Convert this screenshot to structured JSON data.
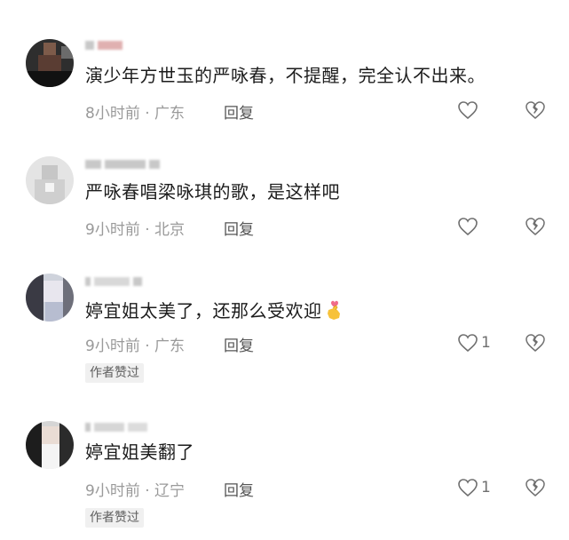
{
  "comments": [
    {
      "text": "演少年方世玉的严咏春，不提醒，完全认不出来。",
      "time": "8小时前",
      "location": "广东",
      "reply_label": "回复",
      "like_count": ""
    },
    {
      "text": "严咏春唱梁咏琪的歌，是这样吧",
      "time": "9小时前",
      "location": "北京",
      "reply_label": "回复",
      "like_count": ""
    },
    {
      "text": "婷宜姐太美了，还那么受欢迎",
      "time": "9小时前",
      "location": "广东",
      "reply_label": "回复",
      "like_count": "1",
      "badge": "作者赞过"
    },
    {
      "text": "婷宜姐美翻了",
      "time": "9小时前",
      "location": "辽宁",
      "reply_label": "回复",
      "like_count": "1",
      "badge": "作者赞过"
    }
  ],
  "separator": " · ",
  "icons": {
    "like": "heart-outline-icon",
    "dislike": "broken-heart-icon",
    "emoji": "heart-hand-emoji"
  },
  "colors": {
    "text": "#1c1c1c",
    "meta": "#9a9a9a",
    "icon": "#6f6f6f",
    "badge_bg": "#f0f0f0"
  }
}
